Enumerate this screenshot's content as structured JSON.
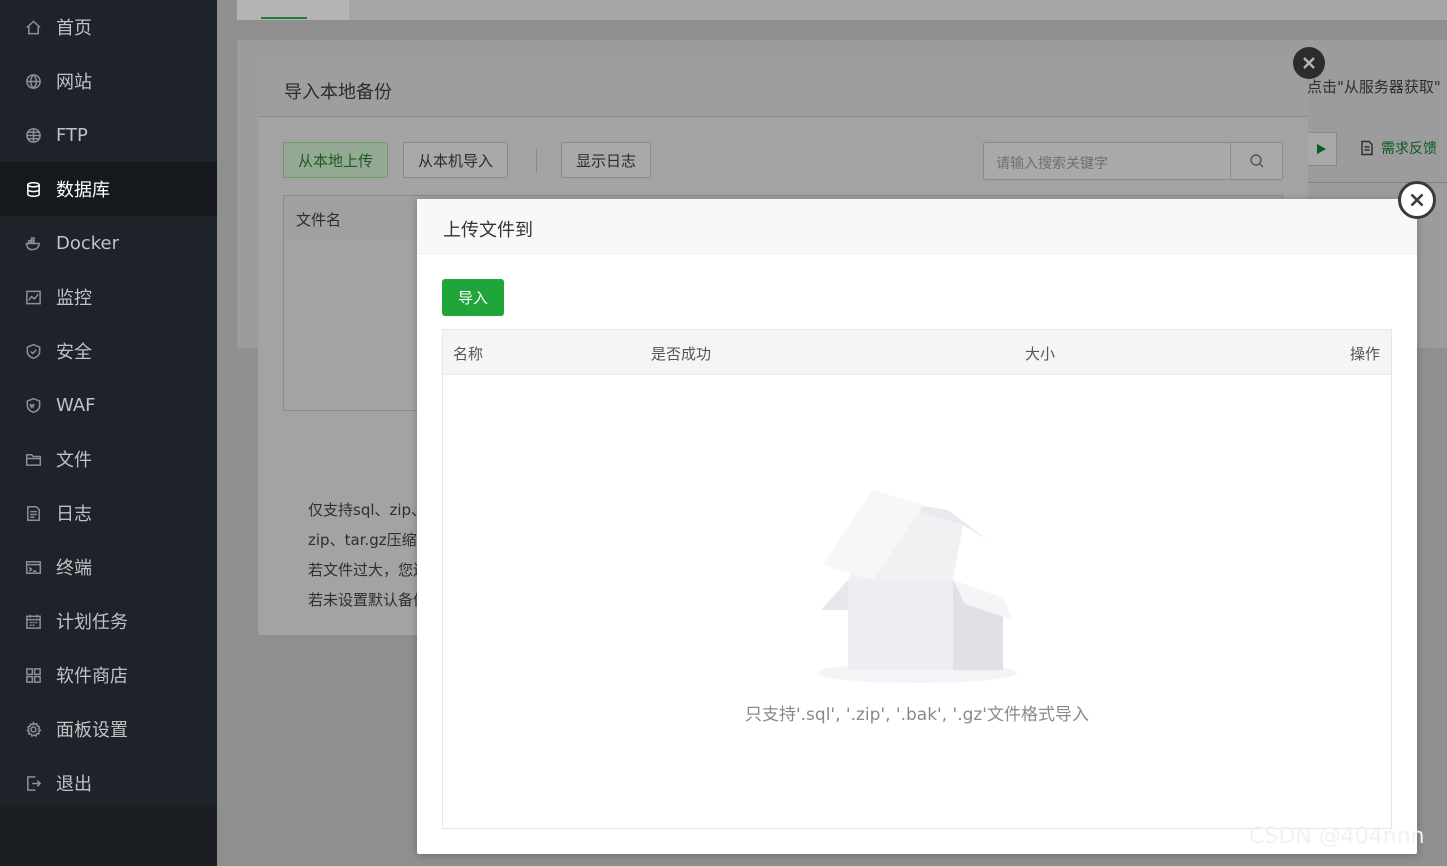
{
  "sidebar": {
    "items": [
      {
        "label": "首页",
        "icon": "home-icon",
        "active": false
      },
      {
        "label": "网站",
        "icon": "globe-icon",
        "active": false
      },
      {
        "label": "FTP",
        "icon": "ftp-globe-icon",
        "active": false
      },
      {
        "label": "数据库",
        "icon": "database-icon",
        "active": true
      },
      {
        "label": "Docker",
        "icon": "docker-icon",
        "active": false
      },
      {
        "label": "监控",
        "icon": "monitor-icon",
        "active": false
      },
      {
        "label": "安全",
        "icon": "shield-icon",
        "active": false
      },
      {
        "label": "WAF",
        "icon": "waf-shield-icon",
        "active": false
      },
      {
        "label": "文件",
        "icon": "folder-icon",
        "active": false
      },
      {
        "label": "日志",
        "icon": "log-icon",
        "active": false
      },
      {
        "label": "终端",
        "icon": "terminal-icon",
        "active": false
      },
      {
        "label": "计划任务",
        "icon": "calendar-icon",
        "active": false
      },
      {
        "label": "软件商店",
        "icon": "grid-icon",
        "active": false
      },
      {
        "label": "面板设置",
        "icon": "gear-icon",
        "active": false
      },
      {
        "label": "退出",
        "icon": "logout-icon",
        "active": false
      }
    ]
  },
  "background": {
    "right_hint": "点击\"从服务器获取\"",
    "feedback_label": "需求反馈"
  },
  "backup_dialog": {
    "title": "导入本地备份",
    "buttons": {
      "upload_local": "从本地上传",
      "import_local": "从本机导入",
      "show_log": "显示日志"
    },
    "search_placeholder": "请输入搜索关键字",
    "table_header": "文件名",
    "notes": [
      "仅支持sql、zip、",
      "zip、tar.gz压缩包",
      "若文件过大，您还",
      "若未设置默认备份"
    ]
  },
  "upload_dialog": {
    "title": "上传文件到",
    "import_button": "导入",
    "columns": {
      "name": "名称",
      "success": "是否成功",
      "size": "大小",
      "action": "操作"
    },
    "empty_text": "只支持'.sql', '.zip', '.bak', '.gz'文件格式导入"
  },
  "watermark": "CSDN @404nnn",
  "colors": {
    "accent_green": "#20a53a",
    "sidebar_bg": "#1e2329"
  }
}
